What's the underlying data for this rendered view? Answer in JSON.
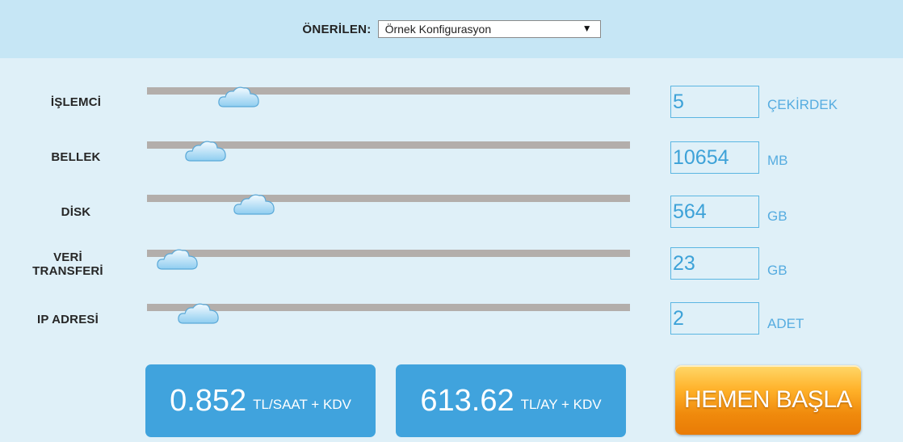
{
  "header": {
    "label": "ÖNERİLEN:",
    "select_value": "Örnek Konfigurasyon",
    "select_arrow": "▼"
  },
  "rows": [
    {
      "label": "İŞLEMCİ",
      "value": "5",
      "unit": "ÇEKİRDEK"
    },
    {
      "label": "BELLEK",
      "value": "10654",
      "unit": "MB"
    },
    {
      "label": "DİSK",
      "value": "564",
      "unit": "GB"
    },
    {
      "label_line1": "VERİ",
      "label_line2": "TRANSFERİ",
      "value": "23",
      "unit": "GB"
    },
    {
      "label": "IP ADRESİ",
      "value": "2",
      "unit": "ADET"
    }
  ],
  "pricing": {
    "hourly_amount": "0.852",
    "hourly_suffix": "TL/SAAT + KDV",
    "monthly_amount": "613.62",
    "monthly_suffix": "TL/AY + KDV"
  },
  "cta_label": "HEMEN BAŞLA",
  "icons": {
    "slider_thumb": "cloud-icon"
  },
  "colors": {
    "background": "#dff0f8",
    "topbar": "#c6e6f5",
    "accent_blue": "#40a3dd",
    "cta_orange": "#f08a0c",
    "track": "#b3aeab"
  }
}
